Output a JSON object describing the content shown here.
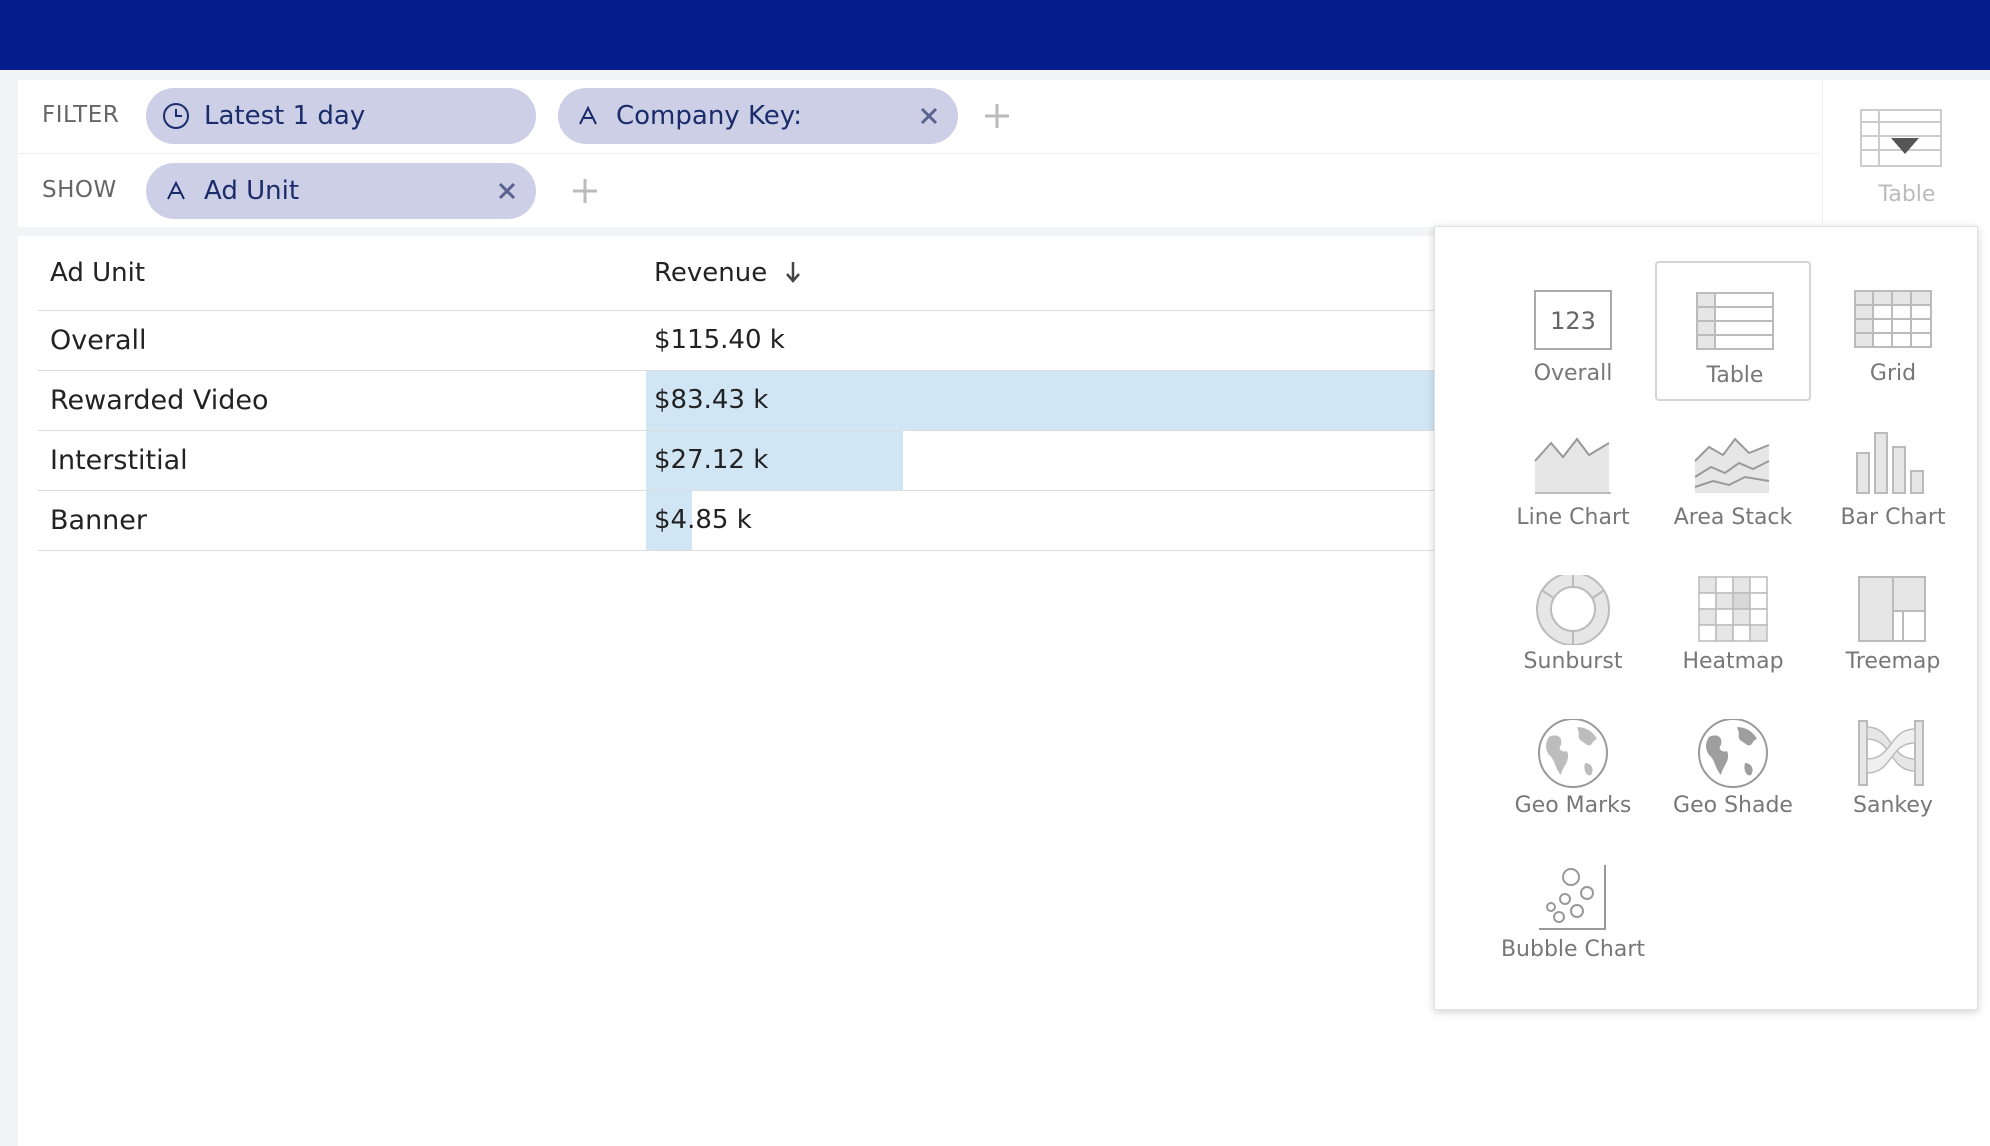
{
  "filter": {
    "label": "FILTER",
    "pills": [
      {
        "text": "Latest 1 day"
      },
      {
        "text": "Company Key:"
      }
    ]
  },
  "show": {
    "label": "SHOW",
    "pills": [
      {
        "text": "Ad Unit"
      }
    ]
  },
  "viz_button": {
    "label": "Table"
  },
  "table": {
    "headers": [
      "Ad Unit",
      "Revenue"
    ],
    "sort_indicator": "arrow-down-icon",
    "rows": [
      {
        "label": "Overall",
        "value": "$115.40 k",
        "bar_fraction": 0
      },
      {
        "label": "Rewarded Video",
        "value": "$83.43 k",
        "bar_fraction": 1.0
      },
      {
        "label": "Interstitial",
        "value": "$27.12 k",
        "bar_fraction": 0.325
      },
      {
        "label": "Banner",
        "value": "$4.85 k",
        "bar_fraction": 0.058
      }
    ],
    "bar_color": "#d1e6f5"
  },
  "viz_menu": {
    "selected": "Table",
    "options": [
      {
        "label": "Overall",
        "icon": "number-icon",
        "icon_text": "123"
      },
      {
        "label": "Table",
        "icon": "table-icon"
      },
      {
        "label": "Grid",
        "icon": "grid-icon"
      },
      {
        "label": "Line Chart",
        "icon": "line-chart-icon"
      },
      {
        "label": "Area Stack",
        "icon": "area-stack-icon"
      },
      {
        "label": "Bar Chart",
        "icon": "bar-chart-icon"
      },
      {
        "label": "Sunburst",
        "icon": "sunburst-icon"
      },
      {
        "label": "Heatmap",
        "icon": "heatmap-icon"
      },
      {
        "label": "Treemap",
        "icon": "treemap-icon"
      },
      {
        "label": "Geo Marks",
        "icon": "globe-icon"
      },
      {
        "label": "Geo Shade",
        "icon": "globe-shaded-icon"
      },
      {
        "label": "Sankey",
        "icon": "sankey-icon"
      },
      {
        "label": "Bubble Chart",
        "icon": "bubble-chart-icon"
      }
    ]
  },
  "colors": {
    "topbar": "#051c8c",
    "pill_bg": "#cccfe6",
    "pill_text": "#1b2c6b"
  }
}
